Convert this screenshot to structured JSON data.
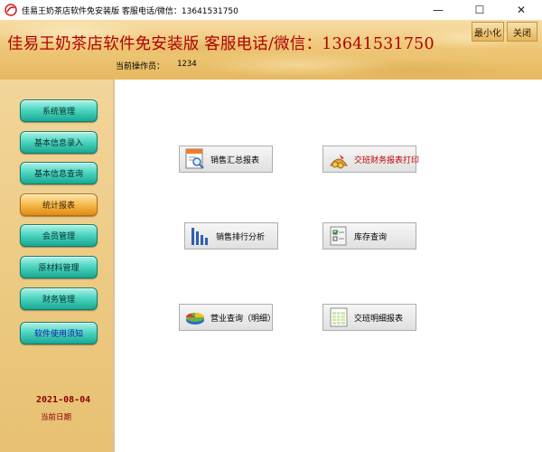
{
  "window": {
    "title": "佳易王奶茶店软件免安装版 客服电话/微信：13641531750",
    "minimize_glyph": "—",
    "maximize_glyph": "☐",
    "close_glyph": "✕"
  },
  "header": {
    "banner_title": "佳易王奶茶店软件免安装版 客服电话/微信：13641531750",
    "operator_label": "当前操作员：",
    "operator_value": "1234",
    "minimize_label": "最小化",
    "close_label": "关闭"
  },
  "sidebar": {
    "items": [
      {
        "label": "系统管理"
      },
      {
        "label": "基本信息录入"
      },
      {
        "label": "基本信息查询"
      },
      {
        "label": "统计报表",
        "active": true
      },
      {
        "label": "会员管理"
      },
      {
        "label": "原材料管理"
      },
      {
        "label": "财务管理"
      },
      {
        "label": "软件使用须知"
      }
    ],
    "date_value": "2021-08-04",
    "date_label": "当前日期"
  },
  "main": {
    "buttons": [
      {
        "label": "销售汇总报表",
        "icon": "report-magnifier-icon"
      },
      {
        "label": "交班财务报表打印",
        "icon": "money-bag-icon"
      },
      {
        "label": "销售排行分析",
        "icon": "bar-chart-icon"
      },
      {
        "label": "库存查询",
        "icon": "checklist-icon"
      },
      {
        "label": "营业查询（明细）",
        "icon": "pie-chart-icon"
      },
      {
        "label": "交班明细报表",
        "icon": "spreadsheet-icon"
      }
    ]
  },
  "colors": {
    "title_red": "#b00000",
    "date_red": "#8b0000",
    "button_teal": "#4fd6c3",
    "button_active_orange": "#f6b94c",
    "notice_blue": "#1a1aa8"
  }
}
